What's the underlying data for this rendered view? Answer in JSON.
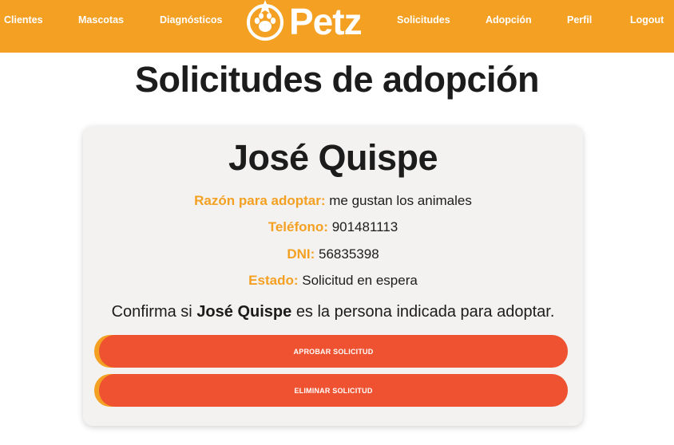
{
  "nav": {
    "left": [
      {
        "label": "Clientes"
      },
      {
        "label": "Mascotas"
      },
      {
        "label": "Diagnósticos"
      }
    ],
    "right": [
      {
        "label": "Solicitudes"
      },
      {
        "label": "Adopción"
      },
      {
        "label": "Perfil"
      },
      {
        "label": "Logout"
      }
    ],
    "logo_text": "Petz"
  },
  "page": {
    "title": "Solicitudes de adopción"
  },
  "request": {
    "name": "José Quispe",
    "reason_label": "Razón para adoptar:",
    "reason": "me gustan los animales",
    "phone_label": "Teléfono:",
    "phone": "901481113",
    "dni_label": "DNI:",
    "dni": "56835398",
    "status_label": "Estado:",
    "status": "Solicitud en espera",
    "confirm_prefix": "Confirma si",
    "confirm_name": "José Quispe",
    "confirm_suffix": "es la persona indicada para adoptar.",
    "approve_label": "Aprobar solicitud",
    "delete_label": "Eliminar solicitud"
  },
  "colors": {
    "brand_orange": "#f4a023",
    "button_red": "#ee5230",
    "card_bg": "#f3f2f0"
  }
}
